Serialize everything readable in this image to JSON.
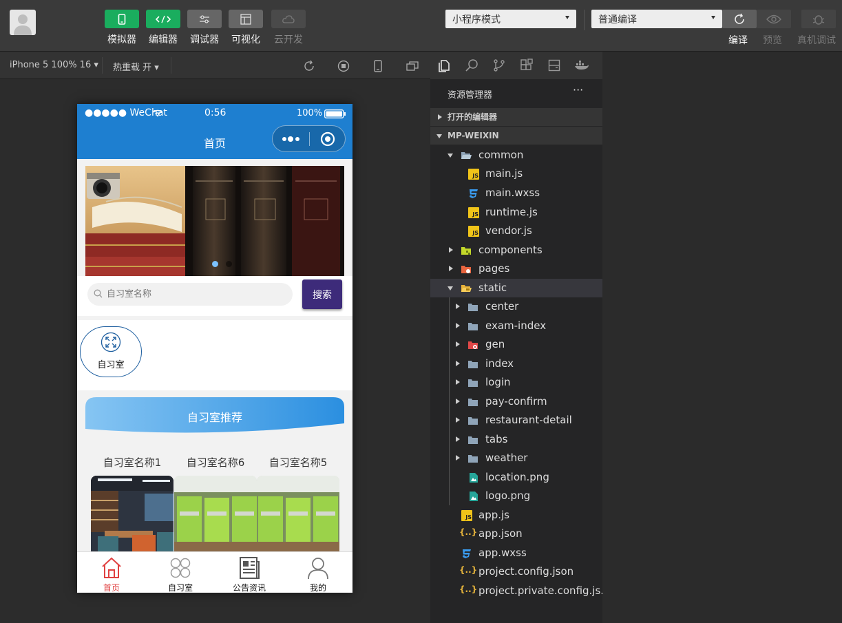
{
  "toolbar": {
    "tools": [
      {
        "label": "模拟器",
        "icon": "phone-icon"
      },
      {
        "label": "编辑器",
        "icon": "code-icon"
      },
      {
        "label": "调试器",
        "icon": "sliders-icon"
      },
      {
        "label": "可视化",
        "icon": "layout-icon"
      },
      {
        "label": "云开发",
        "icon": "cloud-icon"
      }
    ],
    "mode_select": "小程序模式",
    "compile_select": "普通编译",
    "actions": [
      "编译",
      "预览",
      "真机调试"
    ]
  },
  "simulator_bar": {
    "device": "iPhone 5 100% 16 ▾",
    "hot_reload": "热重载 开 ▾"
  },
  "phone": {
    "status": {
      "carrier": "●●●●● WeChat",
      "time": "0:56",
      "battery": "100%"
    },
    "nav_title": "首页",
    "search_placeholder": "自习室名称",
    "search_button": "搜索",
    "category": "自习室",
    "recommend_title": "自习室推荐",
    "rooms": [
      "自习室名称1",
      "自习室名称6",
      "自习室名称5"
    ],
    "tabs": [
      "首页",
      "自习室",
      "公告资讯",
      "我的"
    ],
    "accent": "#1e7fd0"
  },
  "explorer": {
    "title": "资源管理器",
    "more": "···",
    "sections": [
      "打开的编辑器",
      "MP-WEIXIN"
    ],
    "tree": {
      "common": "common",
      "main_js": "main.js",
      "main_wxss": "main.wxss",
      "runtime_js": "runtime.js",
      "vendor_js": "vendor.js",
      "components": "components",
      "pages": "pages",
      "static": "static",
      "center": "center",
      "exam_index": "exam-index",
      "gen": "gen",
      "index": "index",
      "login": "login",
      "pay_confirm": "pay-confirm",
      "restaurant_detail": "restaurant-detail",
      "tabs": "tabs",
      "weather": "weather",
      "location_png": "location.png",
      "logo_png": "logo.png",
      "app_js": "app.js",
      "app_json": "app.json",
      "app_wxss": "app.wxss",
      "project_config": "project.config.json",
      "project_private": "project.private.config.js..."
    }
  }
}
